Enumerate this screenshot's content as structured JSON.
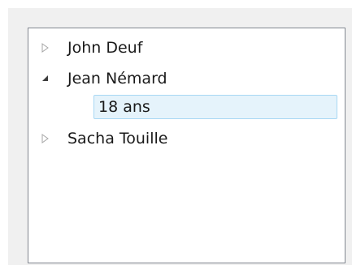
{
  "tree": {
    "items": [
      {
        "label": "John Deuf",
        "expanded": false,
        "arrow_icon": "collapsed-arrow-icon"
      },
      {
        "label": "Jean Némard",
        "expanded": true,
        "arrow_icon": "expanded-arrow-icon",
        "children": [
          {
            "label": "18 ans",
            "selected": true
          }
        ]
      },
      {
        "label": "Sacha Touille",
        "expanded": false,
        "arrow_icon": "collapsed-arrow-icon"
      }
    ]
  },
  "colors": {
    "window_bg": "#f0f0f0",
    "tree_border": "#828790",
    "selection_bg": "#e5f3fb",
    "selection_border": "#a8d8f4"
  }
}
